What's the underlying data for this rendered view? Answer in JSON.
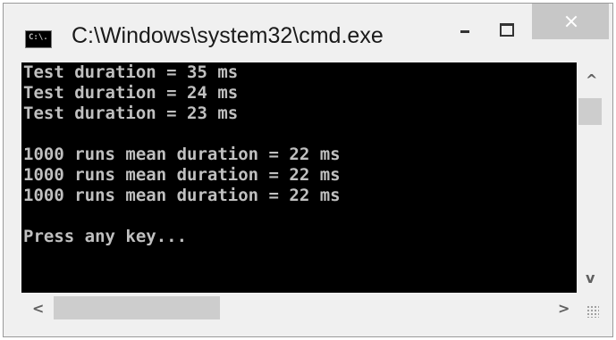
{
  "window": {
    "title": "C:\\Windows\\system32\\cmd.exe",
    "icon_text": "C:\\."
  },
  "console": {
    "lines": [
      "Test duration = 35 ms",
      "Test duration = 24 ms",
      "Test duration = 23 ms",
      "",
      "1000 runs mean duration = 22 ms",
      "1000 runs mean duration = 22 ms",
      "1000 runs mean duration = 22 ms",
      "",
      "Press any key..."
    ]
  },
  "scrollbars": {
    "up_arrow": "^",
    "down_arrow": "v",
    "left_arrow": "<",
    "right_arrow": ">"
  },
  "icons": {
    "app": "cmd-app-icon",
    "minimize": "minimize-icon",
    "maximize": "maximize-icon",
    "close": "close-icon"
  },
  "colors": {
    "console_bg": "#000000",
    "console_text": "#c0c0c0",
    "close_button": "#c7c7c7"
  }
}
